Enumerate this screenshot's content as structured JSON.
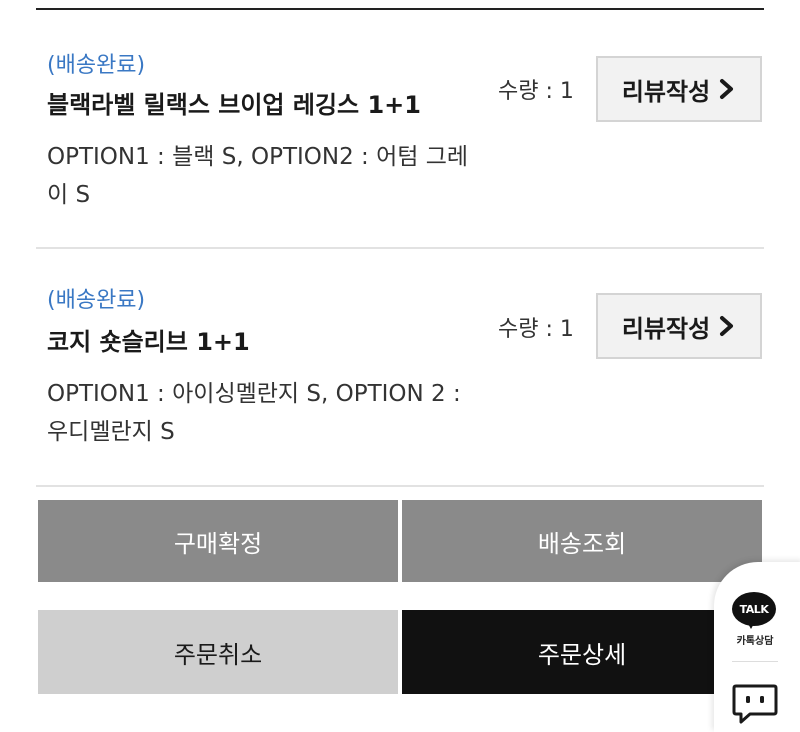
{
  "order_items": [
    {
      "status": "(배송완료)",
      "name": "블랙라벨 릴랙스 브이업 레깅스 1+1",
      "option": "OPTION1 : 블랙 S, OPTION2 : 어텀 그레이 S",
      "quantity": "수량 : 1",
      "review_label": "리뷰작성"
    },
    {
      "status": "(배송완료)",
      "name": "코지 숏슬리브 1+1",
      "option": "OPTION1 : 아이싱멜란지 S, OPTION 2 : 우디멜란지 S",
      "quantity": "수량 : 1",
      "review_label": "리뷰작성"
    }
  ],
  "actions": {
    "confirm_purchase": "구매확정",
    "track_delivery": "배송조회",
    "cancel_order": "주문취소",
    "order_detail": "주문상세"
  },
  "floating": {
    "talk_badge": "TALK",
    "talk_label": "카톡상담",
    "talk_icon": "kakaotalk-icon",
    "chat_icon": "chat-icon"
  },
  "colors": {
    "status": "#3a78c4",
    "primary_button": "#8a8a8a",
    "secondary_button": "#cfcfcf",
    "dark_button": "#111111",
    "review_button_bg": "#f2f2f2"
  }
}
